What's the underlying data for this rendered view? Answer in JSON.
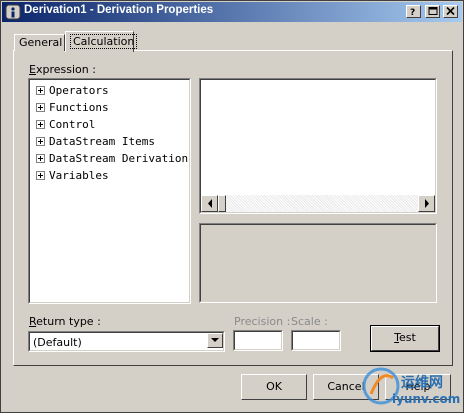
{
  "window": {
    "title": "Derivation1 - Derivation Properties"
  },
  "tabs": [
    {
      "label": "General"
    },
    {
      "label": "Calculation"
    }
  ],
  "expression": {
    "label": "Expression :",
    "tree_items": [
      {
        "label": "Operators"
      },
      {
        "label": "Functions"
      },
      {
        "label": "Control"
      },
      {
        "label": "DataStream Items"
      },
      {
        "label": "DataStream Derivations"
      },
      {
        "label": "Variables"
      }
    ]
  },
  "return_type": {
    "label": "Return type :",
    "value": "(Default)"
  },
  "precision": {
    "label": "Precision :",
    "value": ""
  },
  "scale": {
    "label": "Scale :",
    "value": ""
  },
  "buttons": {
    "test": "Test",
    "ok": "OK",
    "cancel": "Cancel",
    "help": "Help"
  },
  "watermark": {
    "cn": "运维网",
    "url": "iyunv.com"
  }
}
